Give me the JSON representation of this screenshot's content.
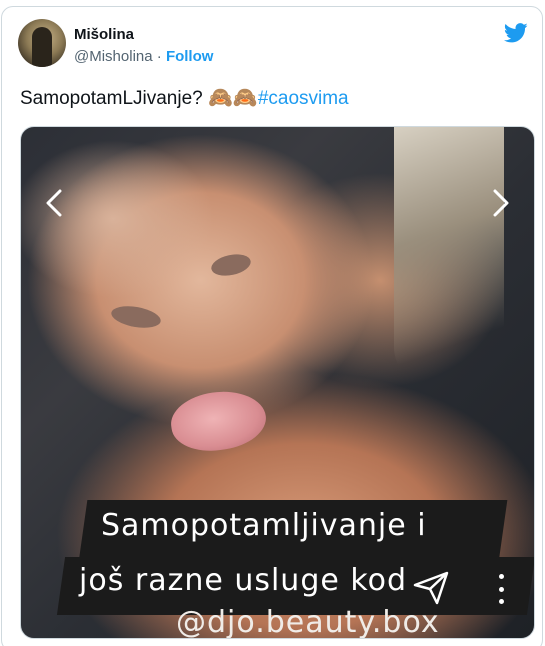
{
  "author": {
    "name": "Mišolina",
    "handle": "@Misholina",
    "separator": "·",
    "follow_label": "Follow"
  },
  "tweet": {
    "text": "SamopotamLJivanje?",
    "emojis": "🙈🙈",
    "hashtag": "#caosvima"
  },
  "media": {
    "caption_lines": [
      "Samopotamljivanje i",
      "još razne usluge kod",
      "@djo.beauty.box"
    ]
  },
  "icons": {
    "brand": "twitter-bird-icon",
    "prev": "chevron-left-icon",
    "next": "chevron-right-icon",
    "more": "more-vertical-icon",
    "send": "paper-plane-icon"
  },
  "colors": {
    "accent": "#1d9bf0",
    "text": "#0f1419",
    "muted": "#536471"
  }
}
